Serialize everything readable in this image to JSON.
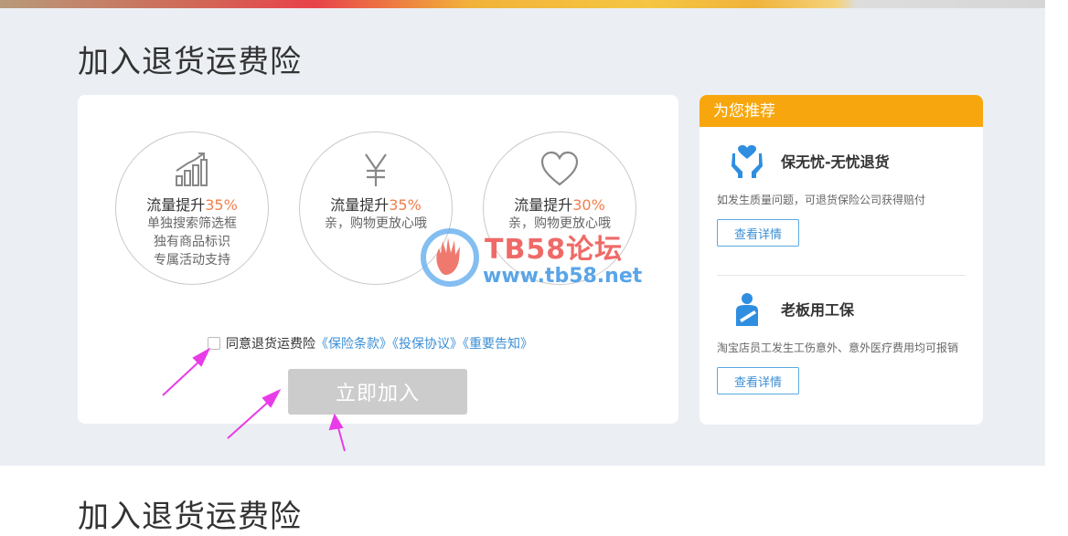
{
  "page": {
    "title": "加入退货运费险",
    "title_repeat": "加入退货运费险"
  },
  "features": [
    {
      "icon": "growth-chart-icon",
      "head": "流量提升",
      "pct": "35%",
      "lines": [
        "单独搜索筛选框",
        "独有商品标识",
        "专属活动支持"
      ]
    },
    {
      "icon": "yen-icon",
      "head": "流量提升",
      "pct": "35%",
      "lines": [
        "亲，购物更放心哦"
      ]
    },
    {
      "icon": "heart-icon",
      "head": "流量提升",
      "pct": "30%",
      "lines": [
        "亲，购物更放心哦"
      ]
    }
  ],
  "agreement": {
    "label": "同意退货运费险",
    "links": [
      "《保险条款》",
      "《投保协议》",
      "《重要告知》"
    ]
  },
  "join_button": "立即加入",
  "sidebar": {
    "header": "为您推荐",
    "items": [
      {
        "icon": "hands-heart-icon",
        "title": "保无忧-无忧退货",
        "desc": "如发生质量问题，可退货保险公司获得赔付",
        "button": "查看详情"
      },
      {
        "icon": "worker-sling-icon",
        "title": "老板用工保",
        "desc": "淘宝店员工发生工伤意外、意外医疗费用均可报销",
        "button": "查看详情"
      }
    ]
  },
  "watermark": {
    "line1": "TB58论坛",
    "line2": "www.tb58.net"
  },
  "colors": {
    "accent": "#f7a70d",
    "link": "#3b8fd6",
    "percent": "#f27e4b",
    "button_disabled": "#cccccc",
    "annotation_arrow": "#e83ce8"
  }
}
